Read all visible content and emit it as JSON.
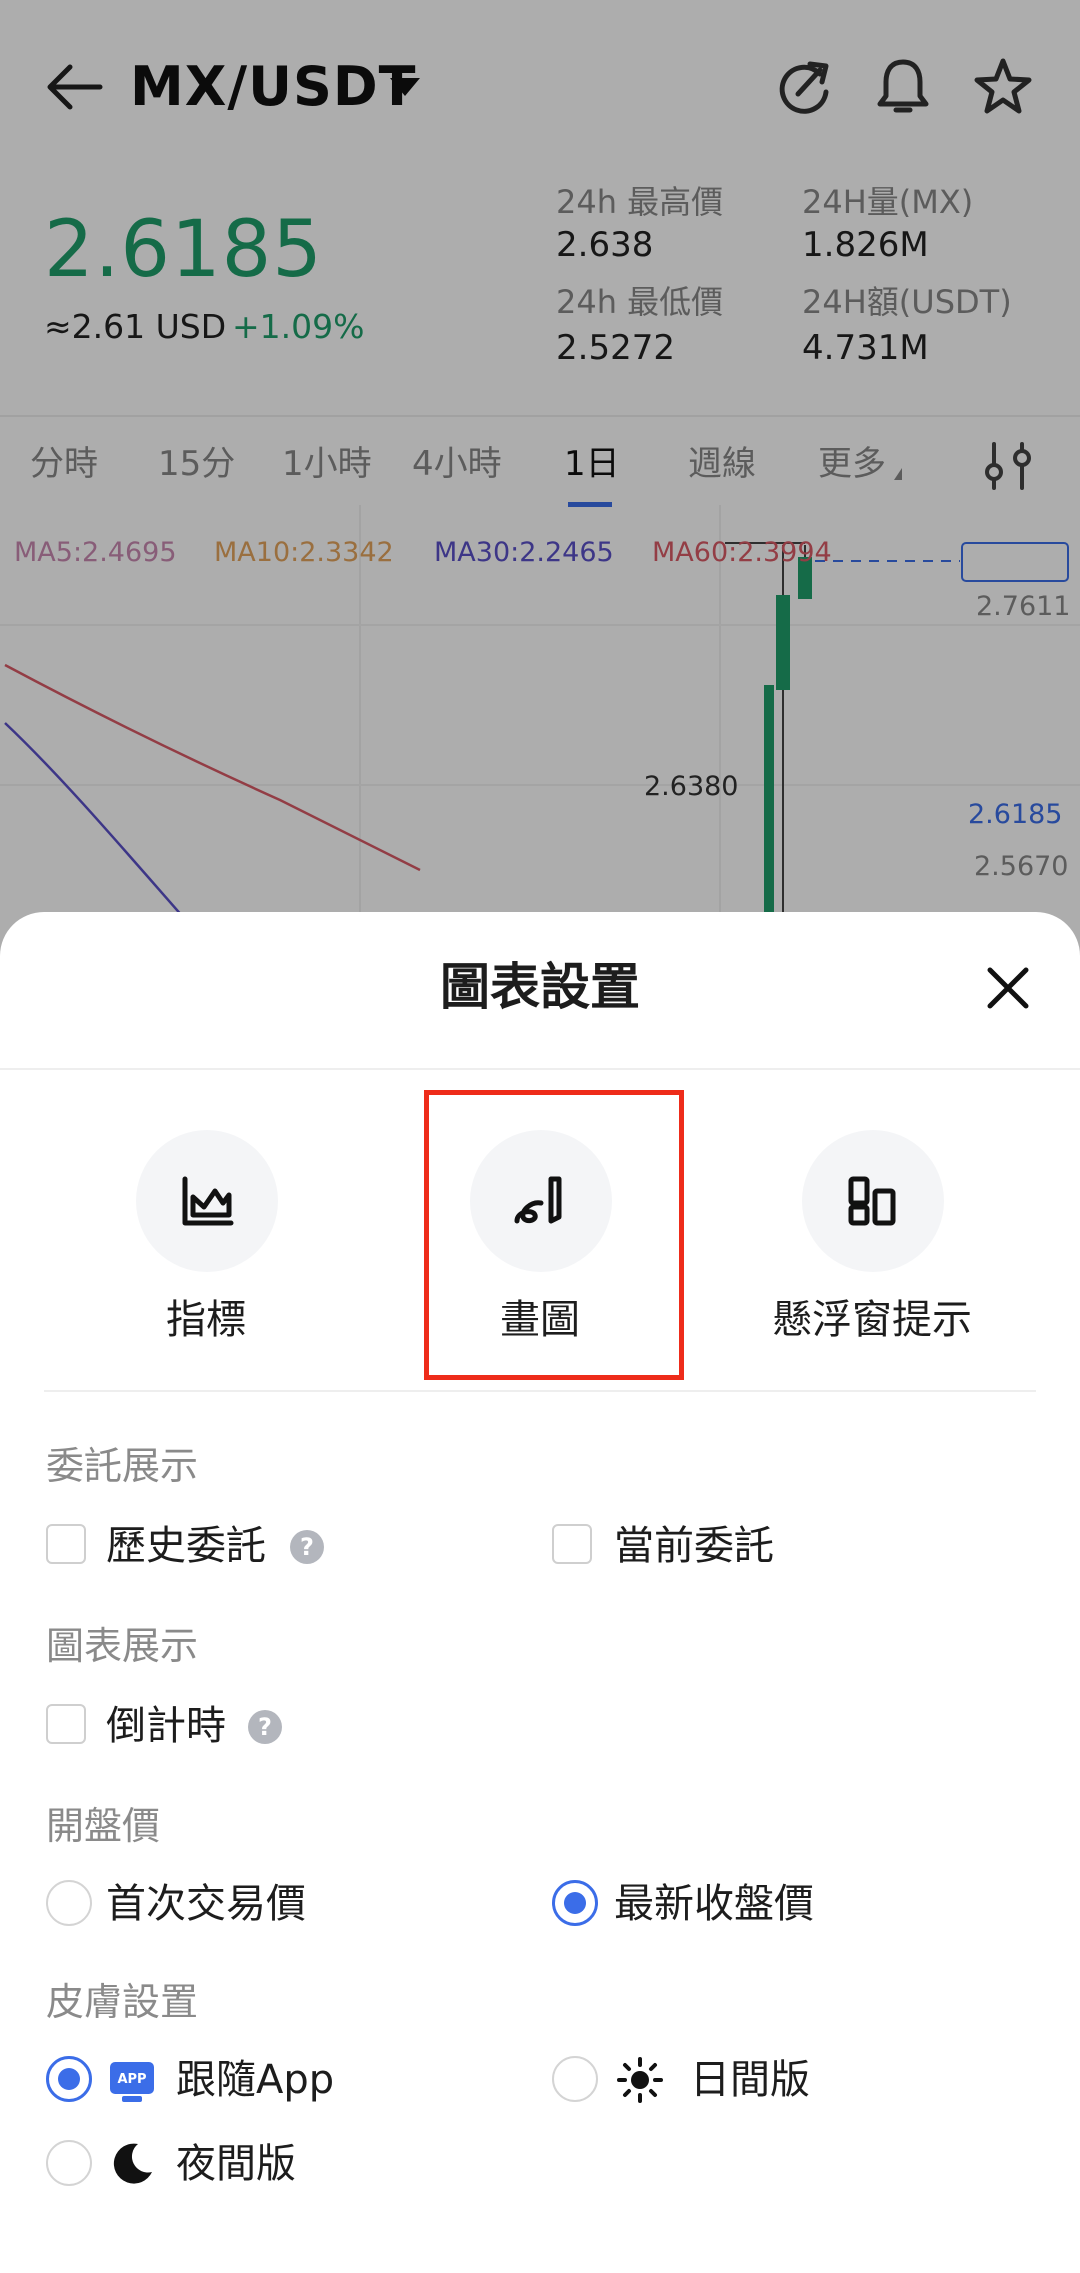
{
  "header": {
    "pair": "MX/USDT"
  },
  "ticker": {
    "price": "2.6185",
    "usd": "≈2.61 USD",
    "change": "+1.09%",
    "high_label": "24h 最高價",
    "high_value": "2.638",
    "low_label": "24h 最低價",
    "low_value": "2.5272",
    "vol_label": "24H量(MX)",
    "vol_value": "1.826M",
    "amount_label": "24H額(USDT)",
    "amount_value": "4.731M"
  },
  "tabs": [
    {
      "label": "分時"
    },
    {
      "label": "15分"
    },
    {
      "label": "1小時"
    },
    {
      "label": "4小時"
    },
    {
      "label": "1日"
    },
    {
      "label": "週線"
    },
    {
      "label": "更多"
    }
  ],
  "chart": {
    "ma5": "MA5:2.4695",
    "ma10": "MA10:2.3342",
    "ma30": "MA30:2.2465",
    "ma60": "MA60:2.3994",
    "axis_top": "2.7611",
    "high_marker": "2.6380",
    "last_price": "2.6185",
    "axis_mid": "2.5670"
  },
  "colors": {
    "up": "#1f9e6b",
    "accent": "#3b6de8",
    "highlight_box": "#ee2c1a",
    "ma5": "#c98ab1",
    "ma10": "#e3a45d",
    "ma30": "#5b50c8",
    "ma60": "#d95a66"
  },
  "sheet": {
    "title": "圖表設置",
    "tools": [
      {
        "label": "指標",
        "icon": "indicator-chart-icon"
      },
      {
        "label": "畫圖",
        "icon": "drawing-pen-icon"
      },
      {
        "label": "懸浮窗提示",
        "icon": "floating-window-icon"
      }
    ],
    "order_section": "委託展示",
    "order_history": "歷史委託",
    "order_current": "當前委託",
    "chart_section": "圖表展示",
    "countdown": "倒計時",
    "open_section": "開盤價",
    "open_first": "首次交易價",
    "open_latest": "最新收盤價",
    "skin_section": "皮膚設置",
    "skin_follow": "跟隨App",
    "skin_follow_badge": "APP",
    "skin_day": "日間版",
    "skin_night": "夜間版",
    "help_glyph": "?"
  }
}
